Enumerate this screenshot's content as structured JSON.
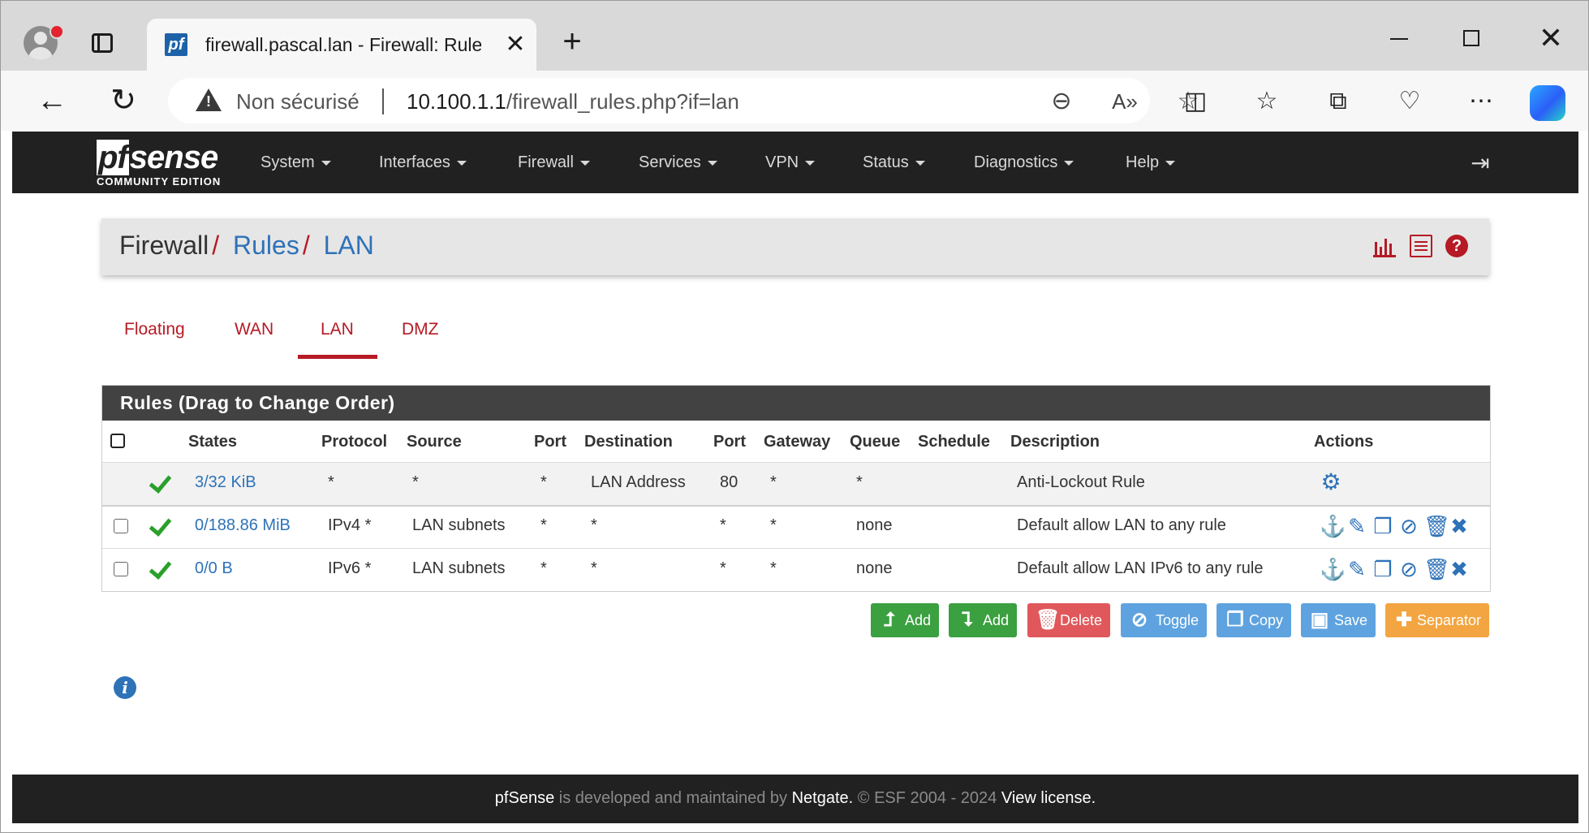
{
  "browser": {
    "tab_title": "firewall.pascal.lan - Firewall: Rules",
    "favicon_text": "pf",
    "new_tab_symbol": "+",
    "close_symbol": "✕",
    "security_label": "Non sécurisé",
    "url_host": "10.100.1.1",
    "url_path": "/firewall_rules.php?if=lan"
  },
  "navbar": {
    "logo_mark_pf": "pf",
    "logo_mark_sense": "sense",
    "logo_sub": "COMMUNITY EDITION",
    "menu": [
      "System",
      "Interfaces",
      "Firewall",
      "Services",
      "VPN",
      "Status",
      "Diagnostics",
      "Help"
    ]
  },
  "breadcrumb": {
    "root": "Firewall",
    "items": [
      "Rules",
      "LAN"
    ],
    "separator": "/"
  },
  "interface_tabs": {
    "items": [
      "Floating",
      "WAN",
      "LAN",
      "DMZ"
    ],
    "active": "LAN"
  },
  "rules": {
    "title": "Rules (Drag to Change Order)",
    "headers": [
      "States",
      "Protocol",
      "Source",
      "Port",
      "Destination",
      "Port",
      "Gateway",
      "Queue",
      "Schedule",
      "Description",
      "Actions"
    ],
    "rows": [
      {
        "states": "3/32 KiB",
        "protocol": "*",
        "source": "*",
        "source_port": "*",
        "destination": "LAN Address",
        "dest_port": "80",
        "gateway": "*",
        "queue": "*",
        "schedule": "",
        "description": "Anti-Lockout Rule"
      },
      {
        "states": "0/188.86 MiB",
        "protocol": "IPv4 *",
        "source": "LAN subnets",
        "source_port": "*",
        "destination": "*",
        "dest_port": "*",
        "gateway": "*",
        "queue": "none",
        "schedule": "",
        "description": "Default allow LAN to any rule"
      },
      {
        "states": "0/0 B",
        "protocol": "IPv6 *",
        "source": "LAN subnets",
        "source_port": "*",
        "destination": "*",
        "dest_port": "*",
        "gateway": "*",
        "queue": "none",
        "schedule": "",
        "description": "Default allow LAN IPv6 to any rule"
      }
    ]
  },
  "buttons": {
    "add_top": "Add",
    "add_bottom": "Add",
    "delete": "Delete",
    "toggle": "Toggle",
    "copy": "Copy",
    "save": "Save",
    "separator": "Separator"
  },
  "footer": {
    "brand": "pfSense",
    "text1": " is developed and maintained by ",
    "company": "Netgate.",
    "text2": " © ESF 2004 - 2024 ",
    "license": "View license."
  },
  "colors": {
    "accent_red": "#b61a24",
    "link_blue": "#2e72b8",
    "navbar_bg": "#212121",
    "success_green": "#3aa040"
  }
}
